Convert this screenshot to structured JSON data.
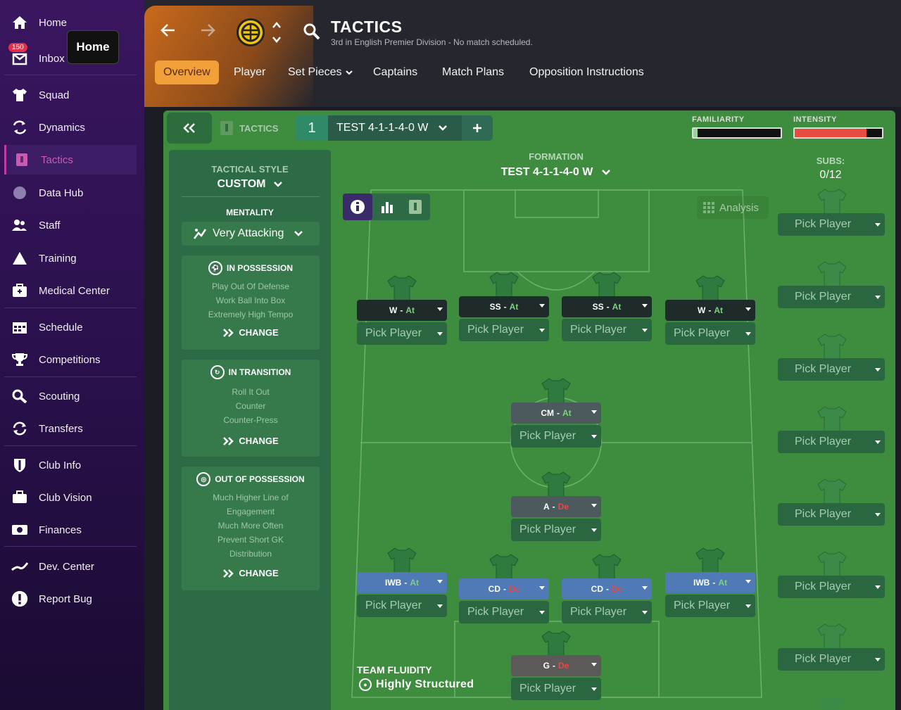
{
  "sidebar": {
    "tooltip": "Home",
    "inbox_badge": "150",
    "items": [
      {
        "label": "Home",
        "icon": "home-icon"
      },
      {
        "label": "Inbox",
        "icon": "inbox-icon"
      },
      {
        "label": "Squad",
        "icon": "shirt-icon"
      },
      {
        "label": "Dynamics",
        "icon": "dynamics-icon"
      },
      {
        "label": "Tactics",
        "icon": "tactics-icon"
      },
      {
        "label": "Data Hub",
        "icon": "data-hub-icon"
      },
      {
        "label": "Staff",
        "icon": "staff-icon"
      },
      {
        "label": "Training",
        "icon": "training-icon"
      },
      {
        "label": "Medical Center",
        "icon": "medical-icon"
      },
      {
        "label": "Schedule",
        "icon": "calendar-icon"
      },
      {
        "label": "Competitions",
        "icon": "trophy-icon"
      },
      {
        "label": "Scouting",
        "icon": "search-icon"
      },
      {
        "label": "Transfers",
        "icon": "transfers-icon"
      },
      {
        "label": "Club Info",
        "icon": "shield-icon"
      },
      {
        "label": "Club Vision",
        "icon": "briefcase-icon"
      },
      {
        "label": "Finances",
        "icon": "money-icon"
      },
      {
        "label": "Dev. Center",
        "icon": "dev-center-icon"
      },
      {
        "label": "Report Bug",
        "icon": "alert-icon"
      }
    ]
  },
  "header": {
    "title": "TACTICS",
    "subtitle": "3rd in English Premier Division - No match scheduled.",
    "tabs": [
      "Overview",
      "Player",
      "Set Pieces",
      "Captains",
      "Match Plans",
      "Opposition Instructions"
    ]
  },
  "toolbar": {
    "section_label": "TACTICS",
    "tactic_number": "1",
    "tactic_name": "TEST 4-1-1-4-0 W",
    "familiarity_label": "FAMILIARITY",
    "intensity_label": "INTENSITY",
    "familiarity_value": 0.05,
    "intensity_value": 0.82,
    "intensity_color": "#e74c3c"
  },
  "style": {
    "tactical_style_label": "TACTICAL STYLE",
    "tactical_style_value": "CUSTOM",
    "mentality_label": "MENTALITY",
    "mentality_value": "Very Attacking",
    "in_possession_title": "IN POSSESSION",
    "in_possession_lines": [
      "Play Out Of Defense",
      "Work Ball Into Box",
      "Extremely High Tempo"
    ],
    "in_transition_title": "IN TRANSITION",
    "in_transition_lines": [
      "Roll It Out",
      "Counter",
      "Counter-Press"
    ],
    "out_possession_title": "OUT OF POSSESSION",
    "out_possession_lines": [
      "Much Higher Line of",
      "Engagement",
      "Much More Often",
      "Prevent Short GK",
      "Distribution"
    ],
    "change_label": "CHANGE"
  },
  "pitch": {
    "formation_label": "FORMATION",
    "formation_name": "TEST 4-1-1-4-0 W",
    "analysis_label": "Analysis",
    "team_fluidity_label": "TEAM FLUIDITY",
    "team_fluidity_value": "Highly Structured",
    "pick_player": "Pick Player",
    "slots": [
      {
        "role": "W",
        "duty": "At"
      },
      {
        "role": "SS",
        "duty": "At"
      },
      {
        "role": "SS",
        "duty": "At"
      },
      {
        "role": "W",
        "duty": "At"
      },
      {
        "role": "CM",
        "duty": "At"
      },
      {
        "role": "A",
        "duty": "De"
      },
      {
        "role": "IWB",
        "duty": "At"
      },
      {
        "role": "CD",
        "duty": "De"
      },
      {
        "role": "CD",
        "duty": "De"
      },
      {
        "role": "IWB",
        "duty": "At"
      },
      {
        "role": "G",
        "duty": "De"
      }
    ]
  },
  "subs": {
    "label": "SUBS:",
    "count": "0/12",
    "pick_player": "Pick Player"
  }
}
